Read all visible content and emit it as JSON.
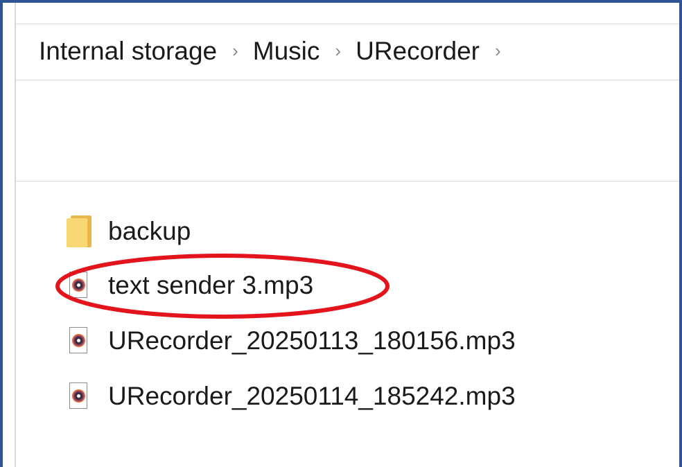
{
  "breadcrumb": {
    "items": [
      "Internal storage",
      "Music",
      "URecorder"
    ],
    "separator": "›"
  },
  "files": [
    {
      "name": "backup",
      "icon": "folder-icon"
    },
    {
      "name": "text sender 3.mp3",
      "icon": "mp3-file-icon"
    },
    {
      "name": "URecorder_20250113_180156.mp3",
      "icon": "mp3-file-icon"
    },
    {
      "name": "URecorder_20250114_185242.mp3",
      "icon": "mp3-file-icon"
    }
  ],
  "annotation": {
    "color": "#e3141b",
    "target": "text sender 3.mp3"
  },
  "colors": {
    "frame_border": "#2f5597",
    "folder_yellow": "#f8d775",
    "separator_gray": "#8a8a8a"
  }
}
